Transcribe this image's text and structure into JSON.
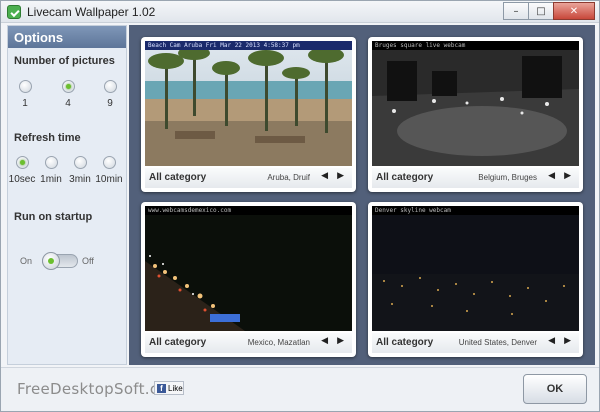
{
  "window": {
    "title": "Livecam Wallpaper 1.02"
  },
  "sidebar": {
    "header": "Options",
    "pictures": {
      "title": "Number of pictures",
      "options": [
        "1",
        "4",
        "9"
      ],
      "selected": "4"
    },
    "refresh": {
      "title": "Refresh time",
      "options": [
        "10sec",
        "1min",
        "3min",
        "10min"
      ],
      "selected": "10sec"
    },
    "startup": {
      "title": "Run on startup",
      "on_label": "On",
      "off_label": "Off",
      "value": "On"
    }
  },
  "cams": [
    {
      "category": "All category",
      "location": "Aruba, Druif",
      "caption": "Beach Cam Aruba Fri Mar 22 2013 4:58:37 pm"
    },
    {
      "category": "All category",
      "location": "Belgium, Bruges",
      "caption": "Bruges square live webcam"
    },
    {
      "category": "All category",
      "location": "Mexico, Mazatlan",
      "caption": "www.webcamsdemexico.com"
    },
    {
      "category": "All category",
      "location": "United States, Denver",
      "caption": "Denver skyline webcam"
    }
  ],
  "footer": {
    "brand": "FreeDesktopSoft.com",
    "like_label": "Like",
    "ok_label": "OK"
  }
}
